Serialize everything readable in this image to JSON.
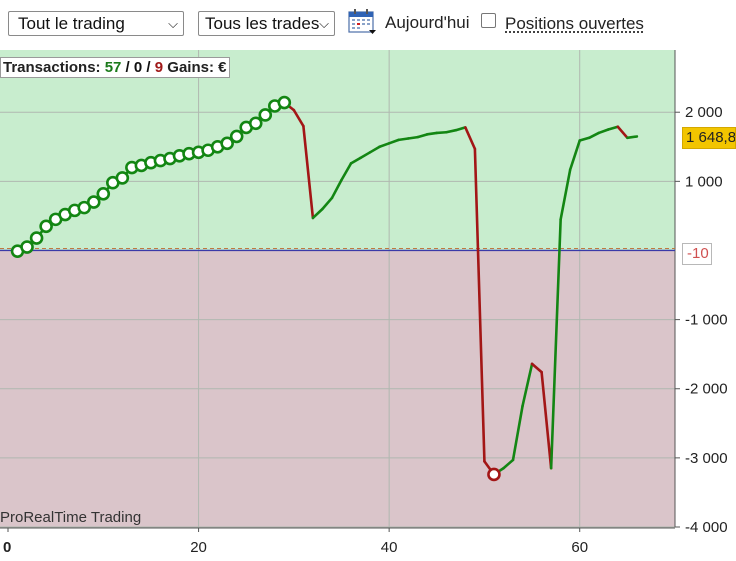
{
  "toolbar": {
    "scope_select": "Tout le trading",
    "trades_select": "Tous les trades",
    "today_label": "Aujourd'hui",
    "open_positions_label": "Positions ouvertes",
    "open_positions_checked": false
  },
  "stats": {
    "transactions_label": "Transactions:",
    "winners": "57",
    "neutral": "0",
    "losers": "9",
    "sep1": " / ",
    "sep2": " / ",
    "gains_label": "Gains:",
    "currency": "€"
  },
  "brand_label": "ProRealTime Trading",
  "price_tag": "1 648,8",
  "zero_tag": "-10",
  "colors": {
    "gain_zone": "#c8edce",
    "loss_zone": "#dac5ca",
    "gain_line": "#138613",
    "loss_line": "#a31616",
    "zero_line": "#3a3aa8",
    "price_tag": "#f2c500"
  },
  "chart_data": {
    "type": "line",
    "title": "",
    "xlabel": "",
    "ylabel": "",
    "xlim": [
      0,
      70
    ],
    "ylim": [
      -4000,
      2900
    ],
    "grid": true,
    "x_ticks": [
      0,
      20,
      40,
      60
    ],
    "x_tick_labels": [
      "0",
      "20",
      "40",
      "60"
    ],
    "y_ticks": [
      2000,
      1000,
      -1000,
      -2000,
      -3000,
      -4000
    ],
    "y_tick_labels": [
      "2 000",
      "1 000",
      "-1 000",
      "-2 000",
      "-3 000",
      "-4 000"
    ],
    "series": [
      {
        "x": [
          1,
          2,
          3,
          4,
          5,
          6,
          7,
          8,
          9,
          10,
          11,
          12,
          13,
          14,
          15,
          16,
          17,
          18,
          19,
          20,
          21,
          22,
          23,
          24,
          25,
          26,
          27,
          28,
          29,
          30,
          31,
          32,
          33,
          34,
          35,
          36,
          37,
          38,
          39,
          40,
          41,
          42,
          43,
          44,
          45,
          46,
          47,
          48,
          49,
          50,
          51,
          52,
          53,
          54,
          55,
          56,
          57,
          58,
          59,
          60,
          61,
          62,
          63,
          64,
          65,
          66
        ],
        "y": [
          -10,
          50,
          180,
          350,
          450,
          520,
          580,
          620,
          700,
          820,
          980,
          1050,
          1200,
          1230,
          1270,
          1300,
          1330,
          1370,
          1400,
          1420,
          1450,
          1500,
          1550,
          1650,
          1780,
          1840,
          1960,
          2090,
          2140,
          2030,
          1800,
          470,
          600,
          760,
          1020,
          1260,
          1340,
          1420,
          1500,
          1550,
          1600,
          1620,
          1640,
          1680,
          1700,
          1710,
          1740,
          1780,
          1470,
          -3050,
          -3240,
          -3150,
          -3030,
          -2250,
          -1640,
          -1760,
          -3150,
          450,
          1170,
          1590,
          1630,
          1700,
          1750,
          1790,
          1630,
          1648.8
        ],
        "marked_points": 29
      }
    ]
  }
}
